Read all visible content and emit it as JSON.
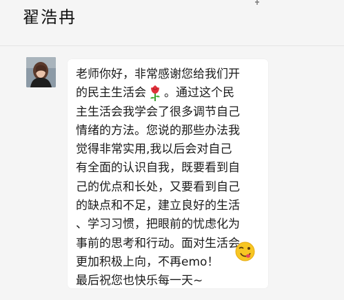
{
  "chat": {
    "contact_name": "翟浩冉"
  },
  "message": {
    "line_1": "老师你好，非常感谢您给我们开",
    "line_2a": "的民主生活会",
    "line_2b": "。通过这个民",
    "line_3": "主生活会我学会了很多调节自己",
    "line_4": "情绪的方法。您说的那些办法我",
    "line_5": "觉得非常实用,我以后会对自己",
    "line_6": "有全面的认识自我，既要看到自",
    "line_7": "己的优点和长处，又要看到自己",
    "line_8": "的缺点和不足，建立良好的生活",
    "line_9": "、学习习惯，把眼前的忧虑化为",
    "line_10": "事前的思考和行动。面对生活会",
    "line_11": "更加积极上向，不再emo！",
    "line_12": "最后祝您也快乐每一天~",
    "emoji_1": "rose-emoji",
    "emoji_2": "winking-face-emoji"
  },
  "icons": {
    "pin": "pin-icon",
    "minimize": "minimize-icon",
    "close": "close-icon"
  },
  "colors": {
    "background": "#f5f5f5",
    "bubble": "#ffffff",
    "text": "#1a1a1a"
  }
}
